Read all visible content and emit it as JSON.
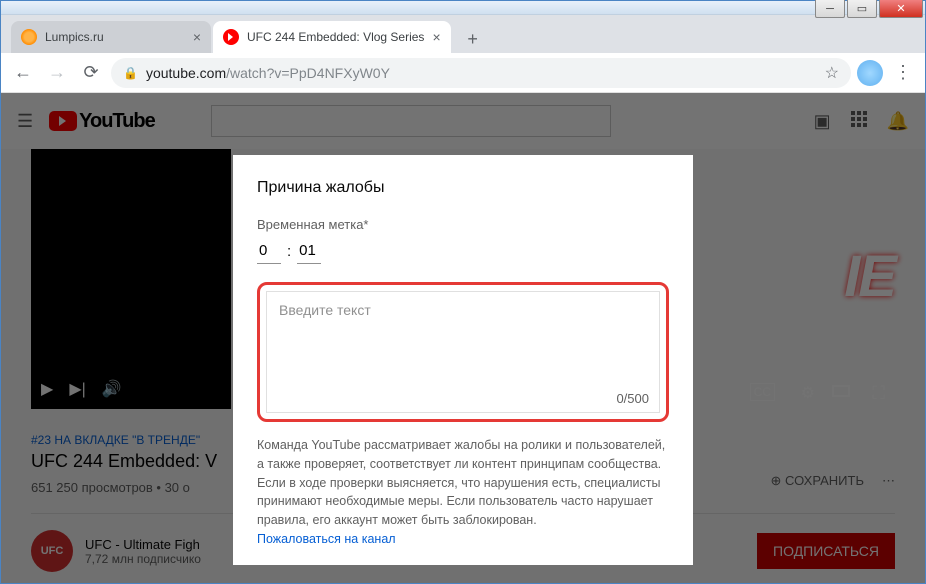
{
  "tabs": [
    {
      "title": "Lumpics.ru"
    },
    {
      "title": "UFC 244 Embedded: Vlog Series"
    }
  ],
  "url": {
    "secure_host": "youtube.com",
    "rest": "/watch?v=PpD4NFXyW0Y"
  },
  "yt": {
    "logo_text": "YouTube",
    "trending_tag": "#23 НА ВКЛАДКЕ \"В ТРЕНДЕ\"",
    "video_title": "UFC 244 Embedded: V",
    "views_meta": "651 250 просмотров • 30 о",
    "action_save": "СОХРАНИТЬ",
    "channel_avatar": "UFC",
    "channel_name": "UFC - Ultimate Figh",
    "channel_subs": "7,72 млн подписчико",
    "subscribe": "ПОДПИСАТЬСЯ",
    "thumb_overlay": "IE"
  },
  "modal": {
    "title": "Причина жалобы",
    "timestamp_label": "Временная метка*",
    "ts_min": "0",
    "ts_sep": ":",
    "ts_sec": "01",
    "text_placeholder": "Введите текст",
    "char_count": "0/500",
    "description": "Команда YouTube рассматривает жалобы на ролики и пользователей, а также проверяет, соответствует ли контент принципам сообщества. Если в ходе проверки выясняется, что нарушения есть, специалисты принимают необходимые меры. Если пользователь часто нарушает правила, его аккаунт может быть заблокирован.",
    "report_link": "Пожаловаться на канал"
  }
}
